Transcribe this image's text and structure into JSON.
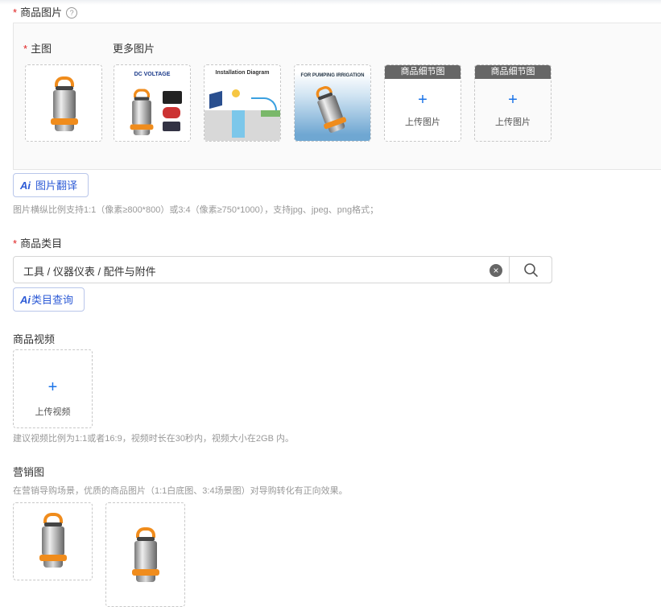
{
  "product_images": {
    "label": "商品图片",
    "main_label": "主图",
    "more_label": "更多图片",
    "items": [
      {
        "name": "main-pump-photo"
      },
      {
        "title": "DC VOLTAGE"
      },
      {
        "title": "Installation Diagram"
      },
      {
        "title": "FOR PUMPING IRRIGATION"
      },
      {
        "header": "商品细节图",
        "action": "上传图片"
      },
      {
        "header": "商品细节图",
        "action": "上传图片"
      }
    ],
    "translate_button": "图片翻译",
    "hint": "图片横纵比例支持1:1（像素≥800*800）或3:4（像素≥750*1000），支持jpg、jpeg、png格式；"
  },
  "category": {
    "label": "商品类目",
    "value": "工具 / 仪器仪表 / 配件与附件",
    "query_button": "类目查询"
  },
  "video": {
    "label": "商品视频",
    "upload_label": "上传视频",
    "hint": "建议视频比例为1:1或者16:9，视频时长在30秒内，视频大小在2GB 内。"
  },
  "marketing": {
    "label": "营销图",
    "hint": "在营销导购场景，优质的商品图片（1:1白底图、3:4场景图）对导购转化有正向效果。"
  },
  "ai_mark": "Ai",
  "colors": {
    "accent": "#1a73e8",
    "required": "#e02020",
    "pump_orange": "#f08c1c"
  }
}
